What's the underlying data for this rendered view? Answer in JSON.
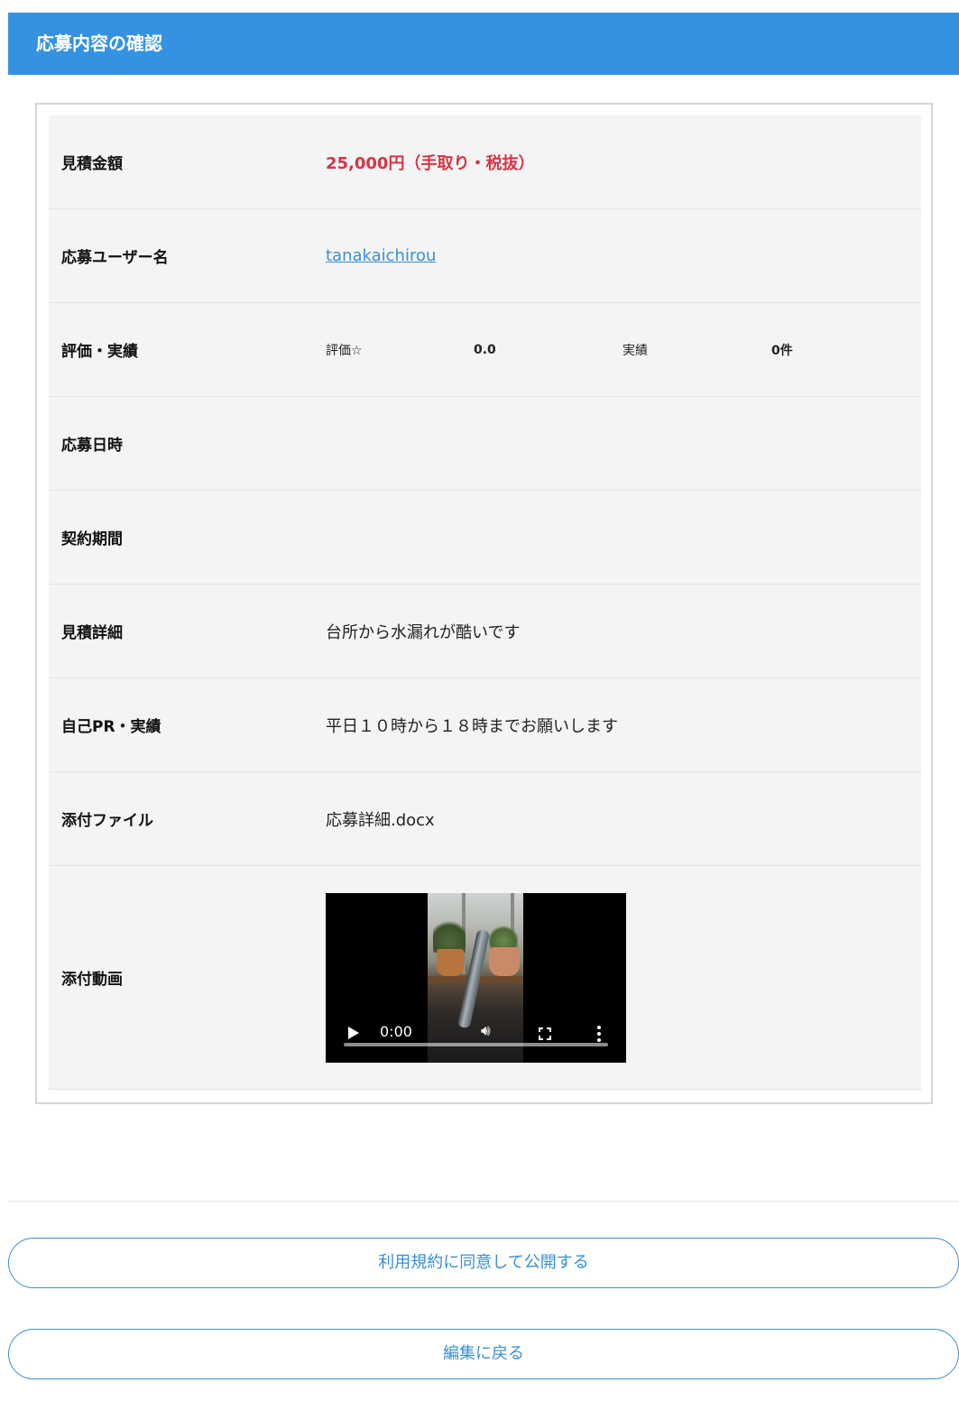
{
  "header": {
    "title": "応募内容の確認"
  },
  "details": {
    "estimate_amount": {
      "label": "見積金額",
      "value": "25,000円（手取り・税抜）"
    },
    "applicant_username": {
      "label": "応募ユーザー名",
      "value": "tanakaichirou"
    },
    "rating_record": {
      "label": "評価・実績",
      "rating_label": "評価☆",
      "rating_value": "0.0",
      "record_label": "実績",
      "record_value": "0件"
    },
    "application_datetime": {
      "label": "応募日時",
      "value": ""
    },
    "contract_period": {
      "label": "契約期間",
      "value": ""
    },
    "estimate_detail": {
      "label": "見積詳細",
      "value": "台所から水漏れが酷いです"
    },
    "self_pr": {
      "label": "自己PR・実績",
      "value": "平日１０時から１８時までお願いします"
    },
    "attached_file": {
      "label": "添付ファイル",
      "value": "応募詳細.docx"
    },
    "attached_video": {
      "label": "添付動画",
      "time": "0:00",
      "icons": {
        "play": "play-icon",
        "volume": "volume-icon",
        "fullscreen": "fullscreen-icon",
        "more": "more-options-icon"
      }
    }
  },
  "actions": {
    "agree_label": "利用規約に同意して公開する",
    "back_label": "編集に戻る"
  },
  "colors": {
    "header_bg": "#3592e2",
    "price_red": "#d63545",
    "link_blue": "#3a8fd6",
    "row_bg": "#f4f4f4"
  }
}
